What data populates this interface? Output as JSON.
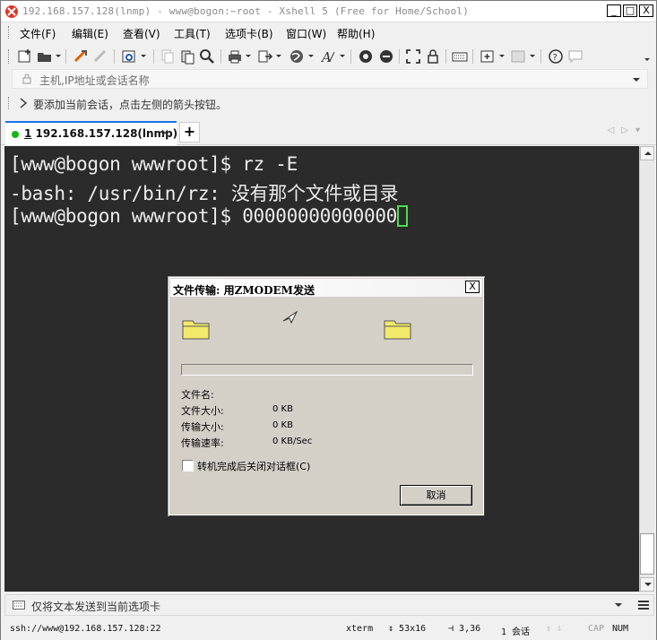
{
  "window": {
    "title": "192.168.157.128(lnmp) - www@bogon:~root - Xshell 5 (Free for Home/School)",
    "controls": {
      "minimize": "_",
      "maximize": "□",
      "close": "X"
    }
  },
  "menu": [
    {
      "label": "文件(F)"
    },
    {
      "label": "编辑(E)"
    },
    {
      "label": "查看(V)"
    },
    {
      "label": "工具(T)"
    },
    {
      "label": "选项卡(B)"
    },
    {
      "label": "窗口(W)"
    },
    {
      "label": "帮助(H)"
    }
  ],
  "address": {
    "placeholder": "主机,IP地址或会话名称"
  },
  "hint": {
    "text": "要添加当前会话，点击左侧的箭头按钮。"
  },
  "tabs": [
    {
      "index": "1",
      "label": "192.168.157.128(lnmp)",
      "close": "×",
      "status_color": "#10b810"
    }
  ],
  "tab_add": "+",
  "terminal": {
    "lines": [
      "[www@bogon wwwroot]$ rz -E",
      "-bash: /usr/bin/rz: 没有那个文件或目录",
      "[www@bogon wwwroot]$ 00000000000000"
    ],
    "cursor_color": "#4ddd4d",
    "background": "#2b2b2b"
  },
  "dialog": {
    "title": "文件传输: 用ZMODEM发送",
    "close": "X",
    "progress": 0,
    "fields": [
      {
        "label": "文件名:",
        "value": ""
      },
      {
        "label": "文件大小:",
        "value": "0 KB"
      },
      {
        "label": "传输大小:",
        "value": "0 KB"
      },
      {
        "label": "传输速率:",
        "value": "0 KB/Sec"
      }
    ],
    "checkbox_label": "转机完成后关闭对话框(C)",
    "checkbox_checked": false,
    "cancel_label": "取消"
  },
  "compose": {
    "text": "仅将文本发送到当前选项卡"
  },
  "status": {
    "connection": "ssh://www@192.168.157.128:22",
    "term": "xterm",
    "size": "53x16",
    "pos": "3,36",
    "sessions": "1 会话",
    "cap": "CAP",
    "num": "NUM"
  }
}
